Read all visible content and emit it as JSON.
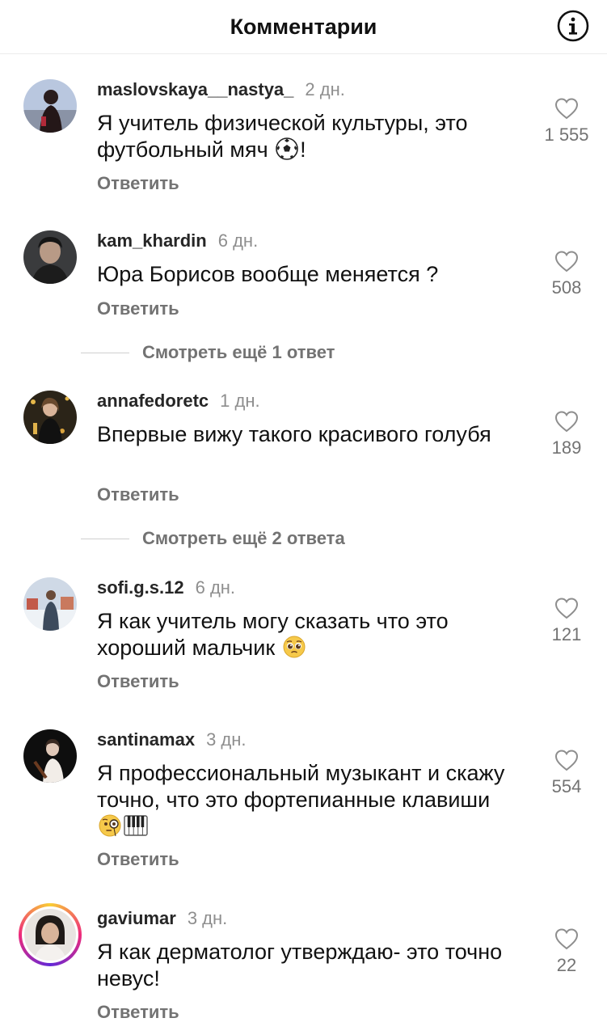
{
  "header": {
    "title": "Комментарии"
  },
  "reply_label": "Ответить",
  "comments": [
    {
      "username": "maslovskaya__nastya_",
      "time": "2 дн.",
      "text": "Я учитель физической культуры, это футбольный мяч",
      "emoji_after": "soccer-ball",
      "text_suffix": "!",
      "likes": "1 555"
    },
    {
      "username": "kam_khardin",
      "time": "6 дн.",
      "text": "Юра Борисов вообще меняется ?",
      "likes": "508"
    },
    {
      "username": "annafedoretc",
      "time": "1 дн.",
      "text": "Впервые вижу такого красивого голубя",
      "likes": "189"
    },
    {
      "username": "sofi.g.s.12",
      "time": "6 дн.",
      "text": "Я как учитель могу сказать что это хороший мальчик",
      "emoji_after": "pleading-face",
      "likes": "121"
    },
    {
      "username": "santinamax",
      "time": "3 дн.",
      "text": "Я профессиональный музыкант и скажу точно, что это фортепианные клавиши",
      "emoji_after": "monocle-face, piano-keys",
      "likes": "554"
    },
    {
      "username": "gaviumar",
      "time": "3 дн.",
      "text": "Я как дерматолог утверждаю- это точно невус!",
      "likes": "22"
    }
  ],
  "view_more": [
    {
      "label": "Смотреть ещё 1 ответ"
    },
    {
      "label": "Смотреть ещё 2 ответа"
    }
  ]
}
